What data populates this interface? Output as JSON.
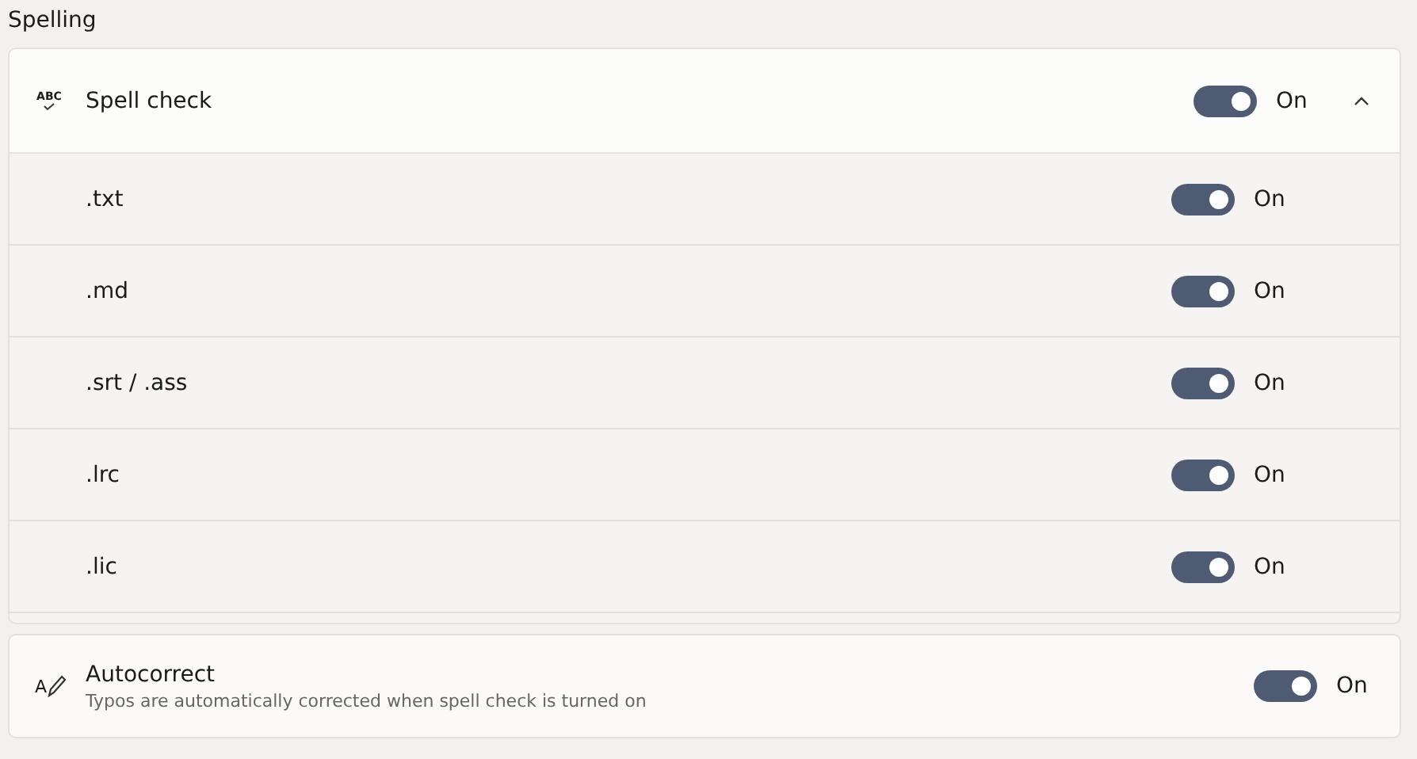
{
  "section_title": "Spelling",
  "spell_check": {
    "icon_text": "ABC",
    "label": "Spell check",
    "on": true,
    "state_label": "On",
    "expanded": true,
    "items": [
      {
        "label": ".txt",
        "on": true,
        "state_label": "On"
      },
      {
        "label": ".md",
        "on": true,
        "state_label": "On"
      },
      {
        "label": ".srt / .ass",
        "on": true,
        "state_label": "On"
      },
      {
        "label": ".lrc",
        "on": true,
        "state_label": "On"
      },
      {
        "label": ".lic",
        "on": true,
        "state_label": "On"
      }
    ]
  },
  "autocorrect": {
    "icon_text": "A",
    "label": "Autocorrect",
    "description": "Typos are automatically corrected when spell check is turned on",
    "on": true,
    "state_label": "On"
  }
}
